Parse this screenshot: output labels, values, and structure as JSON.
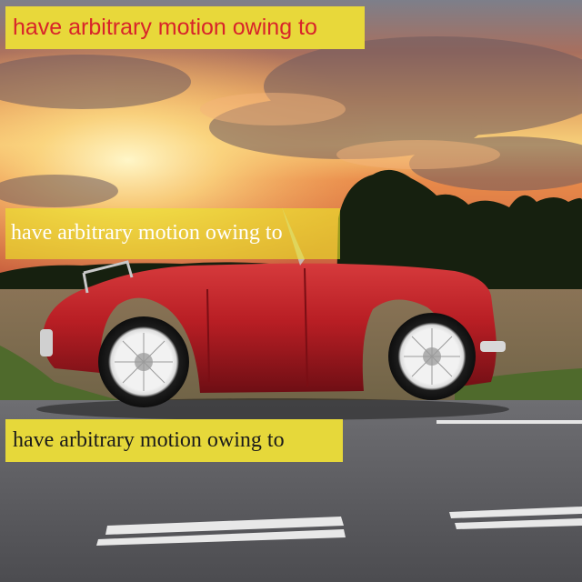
{
  "captions": {
    "top": "have arbitrary motion owing to",
    "middle": "have arbitrary motion owing to",
    "bottom": "have arbitrary motion owing to"
  },
  "colors": {
    "car_body": "#b81e24",
    "caption_bg": "#e8d83a",
    "top_caption_text": "#d8242a",
    "middle_caption_text": "#ffffff",
    "bottom_caption_text": "#1b1b1b",
    "road": "#5a5a5e"
  }
}
